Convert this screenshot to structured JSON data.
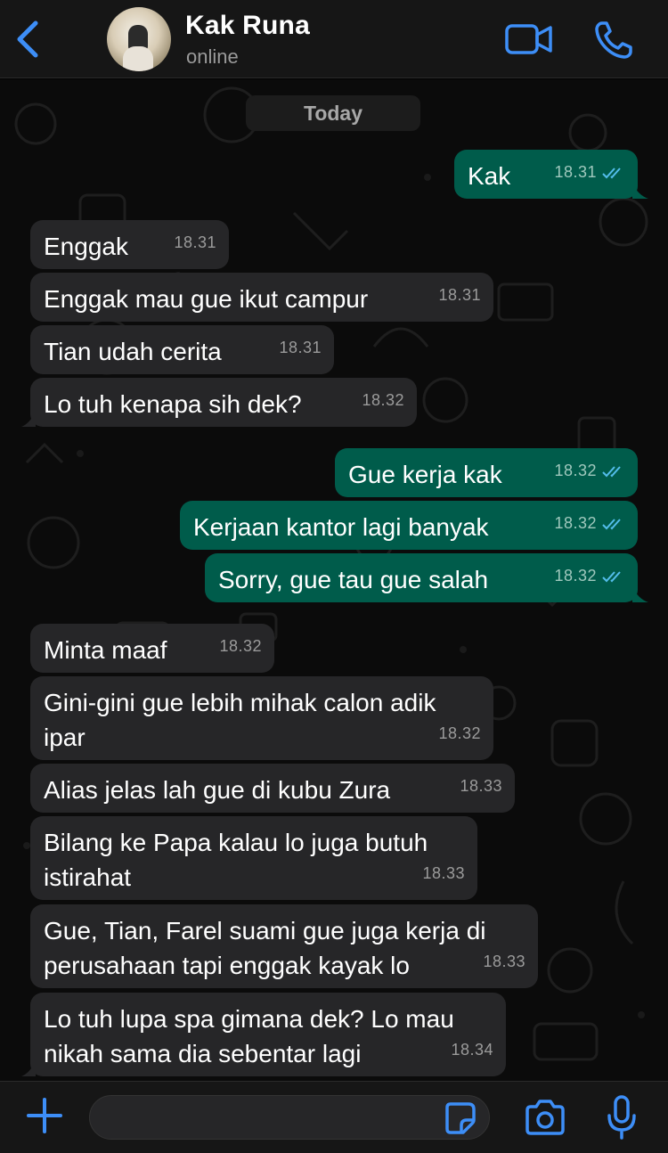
{
  "header": {
    "contact_name": "Kak Runa",
    "status": "online",
    "icons": {
      "back": "chevron-left-icon",
      "video": "video-camera-icon",
      "call": "phone-icon"
    }
  },
  "date_divider": "Today",
  "messages": [
    {
      "dir": "out",
      "text": "Kak",
      "time": "18.31",
      "read": true
    },
    {
      "dir": "in",
      "text": "Enggak",
      "time": "18.31"
    },
    {
      "dir": "in",
      "text": "Enggak mau gue ikut campur",
      "time": "18.31"
    },
    {
      "dir": "in",
      "text": "Tian udah cerita",
      "time": "18.31"
    },
    {
      "dir": "in",
      "text": "Lo tuh kenapa sih dek?",
      "time": "18.32"
    },
    {
      "dir": "out",
      "text": "Gue kerja kak",
      "time": "18.32",
      "read": true
    },
    {
      "dir": "out",
      "text": "Kerjaan kantor lagi banyak",
      "time": "18.32",
      "read": true
    },
    {
      "dir": "out",
      "text": "Sorry, gue tau gue salah",
      "time": "18.32",
      "read": true
    },
    {
      "dir": "in",
      "text": "Minta maaf",
      "time": "18.32"
    },
    {
      "dir": "in",
      "text": "Gini-gini gue lebih mihak calon adik ipar",
      "time": "18.32"
    },
    {
      "dir": "in",
      "text": "Alias jelas lah gue di kubu Zura",
      "time": "18.33"
    },
    {
      "dir": "in",
      "text": "Bilang ke Papa kalau lo juga butuh istirahat",
      "time": "18.33"
    },
    {
      "dir": "in",
      "text": "Gue, Tian, Farel suami gue juga kerja di perusahaan tapi enggak kayak lo",
      "time": "18.33"
    },
    {
      "dir": "in",
      "text": "Lo tuh lupa spa gimana dek? Lo mau nikah sama dia sebentar lagi",
      "time": "18.34"
    }
  ],
  "composer": {
    "placeholder": "",
    "icons": {
      "plus": "plus-icon",
      "sticker": "sticker-icon",
      "camera": "camera-icon",
      "mic": "microphone-icon"
    }
  },
  "colors": {
    "accent": "#3d8ef7",
    "bubble_out": "#005c4b",
    "bubble_in": "#262628",
    "background": "#0b0b0b",
    "read_tick": "#53bdeb"
  }
}
